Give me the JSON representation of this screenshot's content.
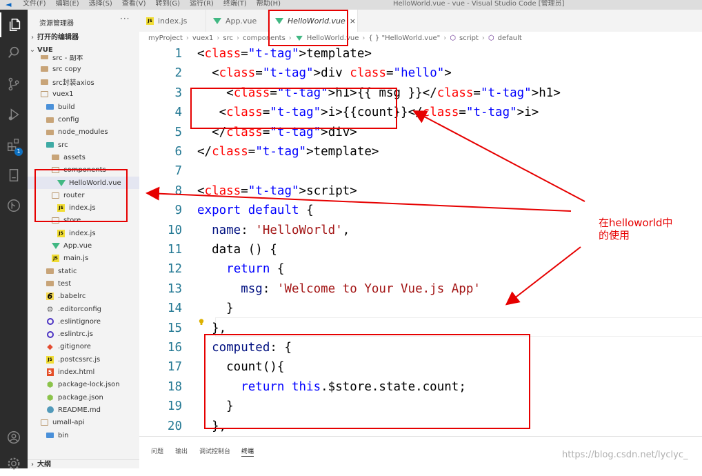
{
  "titlebar": {
    "menus": [
      "文件(F)",
      "编辑(E)",
      "选择(S)",
      "查看(V)",
      "转到(G)",
      "运行(R)",
      "终端(T)",
      "帮助(H)"
    ],
    "window_title": "HelloWorld.vue - vue - Visual Studio Code [管理员]"
  },
  "activity_bar": {
    "extensions_badge": "1",
    "icons": [
      "explorer-icon",
      "search-icon",
      "source-control-icon",
      "run-debug-icon",
      "extensions-icon",
      "book-icon",
      "git-graph-icon",
      "account-icon",
      "settings-icon"
    ]
  },
  "sidebar": {
    "title": "资源管理器",
    "more": "···",
    "open_editors": "打开的编辑器",
    "workspace": "VUE",
    "outline": "大纲",
    "tree": [
      {
        "label": "src - 副本",
        "icon": "folder",
        "depth": 0
      },
      {
        "label": "src copy",
        "icon": "folder",
        "depth": 0
      },
      {
        "label": "src封装axios",
        "icon": "folder",
        "depth": 0
      },
      {
        "label": "vuex1",
        "icon": "folder-open",
        "depth": 0
      },
      {
        "label": "build",
        "icon": "folder-blue",
        "depth": 1
      },
      {
        "label": "config",
        "icon": "folder",
        "depth": 1
      },
      {
        "label": "node_modules",
        "icon": "folder",
        "depth": 1
      },
      {
        "label": "src",
        "icon": "folder-teal",
        "depth": 1
      },
      {
        "label": "assets",
        "icon": "folder",
        "depth": 2
      },
      {
        "label": "components",
        "icon": "folder-open",
        "depth": 2
      },
      {
        "label": "HelloWorld.vue",
        "icon": "vue",
        "depth": 3,
        "selected": true
      },
      {
        "label": "router",
        "icon": "folder-open",
        "depth": 2
      },
      {
        "label": "index.js",
        "icon": "js",
        "depth": 3
      },
      {
        "label": "store",
        "icon": "folder-open",
        "depth": 2
      },
      {
        "label": "index.js",
        "icon": "js",
        "depth": 3
      },
      {
        "label": "App.vue",
        "icon": "vue",
        "depth": 2
      },
      {
        "label": "main.js",
        "icon": "js",
        "depth": 2
      },
      {
        "label": "static",
        "icon": "folder",
        "depth": 1
      },
      {
        "label": "test",
        "icon": "folder",
        "depth": 1
      },
      {
        "label": ".babelrc",
        "icon": "babel",
        "depth": 1
      },
      {
        "label": ".editorconfig",
        "icon": "gear",
        "depth": 1
      },
      {
        "label": ".eslintignore",
        "icon": "eslint",
        "depth": 1
      },
      {
        "label": ".eslintrc.js",
        "icon": "eslint",
        "depth": 1
      },
      {
        "label": ".gitignore",
        "icon": "git",
        "depth": 1
      },
      {
        "label": ".postcssrc.js",
        "icon": "js",
        "depth": 1
      },
      {
        "label": "index.html",
        "icon": "html",
        "depth": 1
      },
      {
        "label": "package-lock.json",
        "icon": "npm",
        "depth": 1
      },
      {
        "label": "package.json",
        "icon": "npm",
        "depth": 1
      },
      {
        "label": "README.md",
        "icon": "info",
        "depth": 1
      },
      {
        "label": "umall-api",
        "icon": "folder-open",
        "depth": 0
      },
      {
        "label": "bin",
        "icon": "folder-blue",
        "depth": 1
      }
    ]
  },
  "tabs": [
    {
      "label": "index.js",
      "icon": "js"
    },
    {
      "label": "App.vue",
      "icon": "vue"
    },
    {
      "label": "HelloWorld.vue",
      "icon": "vue",
      "active": true,
      "close": "×"
    }
  ],
  "breadcrumb": [
    "myProject",
    "vuex1",
    "src",
    "components",
    "HelloWorld.vue",
    "{ } \"HelloWorld.vue\"",
    "script",
    "default"
  ],
  "code_lines": [
    {
      "n": "1",
      "text": "<template>"
    },
    {
      "n": "2",
      "text": "  <div class=\"hello\">"
    },
    {
      "n": "3",
      "text": "    <h1>{{ msg }}</h1>"
    },
    {
      "n": "4",
      "text": "   <i>{{count}}</i>"
    },
    {
      "n": "5",
      "text": "  </div>"
    },
    {
      "n": "6",
      "text": "</template>"
    },
    {
      "n": "7",
      "text": ""
    },
    {
      "n": "8",
      "text": "<script>"
    },
    {
      "n": "9",
      "text": "export default {"
    },
    {
      "n": "10",
      "text": "  name: 'HelloWorld',"
    },
    {
      "n": "11",
      "text": "  data () {"
    },
    {
      "n": "12",
      "text": "    return {"
    },
    {
      "n": "13",
      "text": "      msg: 'Welcome to Your Vue.js App'"
    },
    {
      "n": "14",
      "text": "    }"
    },
    {
      "n": "15",
      "text": "  },"
    },
    {
      "n": "16",
      "text": "  computed: {"
    },
    {
      "n": "17",
      "text": "    count(){"
    },
    {
      "n": "18",
      "text": "      return this.$store.state.count;"
    },
    {
      "n": "19",
      "text": "    }"
    },
    {
      "n": "20",
      "text": "  },"
    }
  ],
  "panel_tabs": [
    "问题",
    "输出",
    "调试控制台",
    "终端"
  ],
  "annotation": {
    "line1": "在helloworld中",
    "line2": "的使用",
    "color": "#e60000"
  },
  "watermark": "https://blog.csdn.net/lyclyc_"
}
